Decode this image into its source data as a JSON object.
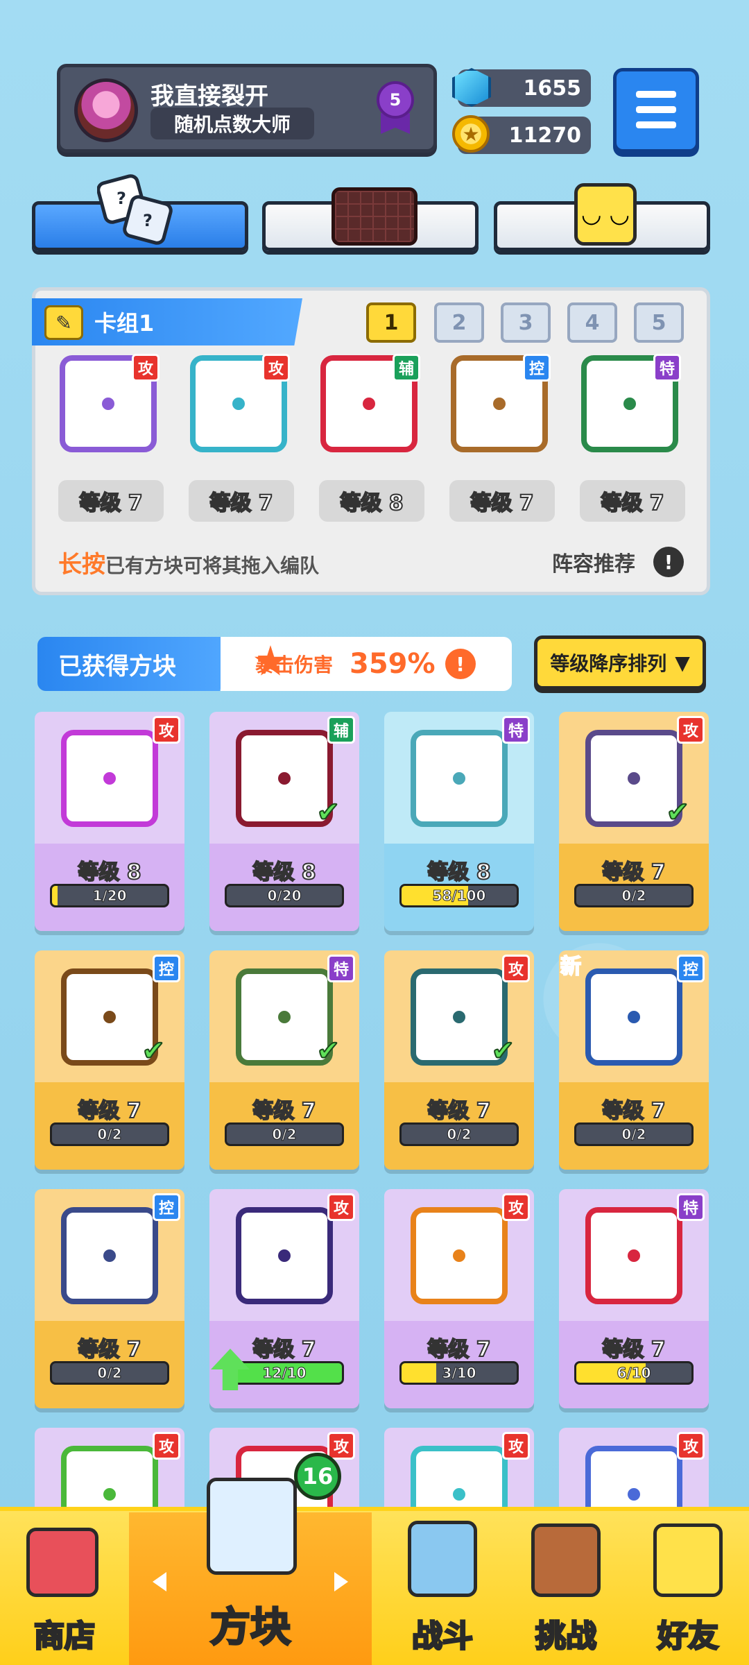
{
  "profile": {
    "name": "我直接裂开",
    "title": "随机点数大师",
    "rank_level": "5"
  },
  "currency": {
    "gems": "1655",
    "coins": "11270"
  },
  "deck": {
    "title": "卡组1",
    "numbers": [
      "1",
      "2",
      "3",
      "4",
      "5"
    ],
    "active_number": "1",
    "slots": [
      {
        "role": "攻",
        "level": "等级 7",
        "color": "#8a5bd6"
      },
      {
        "role": "攻",
        "level": "等级 7",
        "color": "#36b3c9"
      },
      {
        "role": "辅",
        "level": "等级 8",
        "color": "#d8263f"
      },
      {
        "role": "控",
        "level": "等级 7",
        "color": "#a86b2a"
      },
      {
        "role": "特",
        "level": "等级 7",
        "color": "#2a8a4a"
      }
    ],
    "hint_accent": "长按",
    "hint_rest": "已有方块可将其拖入编队",
    "lineup_label": "阵容推荐"
  },
  "owned": {
    "title": "已获得方块",
    "crit_label": "暴击伤害",
    "crit_value": "359%",
    "sort_label": "等级降序排列"
  },
  "cards": [
    {
      "role": "攻",
      "level": "等级 8",
      "progress": "1/20",
      "fill": 0.05,
      "theme": "purple",
      "color": "#c23ad8"
    },
    {
      "role": "辅",
      "level": "等级 8",
      "progress": "0/20",
      "fill": 0,
      "theme": "purple",
      "color": "#8a1a30",
      "check": true
    },
    {
      "role": "特",
      "level": "等级 8",
      "progress": "58/100",
      "fill": 0.58,
      "theme": "blue",
      "color": "#4aa8b8"
    },
    {
      "role": "攻",
      "level": "等级 7",
      "progress": "0/2",
      "fill": 0,
      "theme": "gold",
      "color": "#5a4a8a",
      "check": true
    },
    {
      "role": "控",
      "level": "等级 7",
      "progress": "0/2",
      "fill": 0,
      "theme": "gold",
      "color": "#7a4a1a",
      "check": true
    },
    {
      "role": "特",
      "level": "等级 7",
      "progress": "0/2",
      "fill": 0,
      "theme": "gold",
      "color": "#4a7a3a",
      "check": true
    },
    {
      "role": "攻",
      "level": "等级 7",
      "progress": "0/2",
      "fill": 0,
      "theme": "gold",
      "color": "#2a6a70",
      "check": true
    },
    {
      "role": "控",
      "level": "等级 7",
      "progress": "0/2",
      "fill": 0,
      "theme": "gold",
      "color": "#2a5ab0",
      "new": "新"
    },
    {
      "role": "控",
      "level": "等级 7",
      "progress": "0/2",
      "fill": 0,
      "theme": "gold",
      "color": "#3a4a8a"
    },
    {
      "role": "攻",
      "level": "等级 7",
      "progress": "12/10",
      "fill": 1,
      "theme": "purple",
      "color": "#3a2a7a",
      "upgrade": true
    },
    {
      "role": "攻",
      "level": "等级 7",
      "progress": "3/10",
      "fill": 0.3,
      "theme": "purple",
      "color": "#e8821a"
    },
    {
      "role": "特",
      "level": "等级 7",
      "progress": "6/10",
      "fill": 0.6,
      "theme": "purple",
      "color": "#d8263f"
    },
    {
      "role": "攻",
      "theme": "purple",
      "color": "#4ab83a"
    },
    {
      "role": "攻",
      "theme": "purple",
      "color": "#d8263f"
    },
    {
      "role": "攻",
      "theme": "purple",
      "color": "#3ac0c8"
    },
    {
      "role": "攻",
      "theme": "purple",
      "color": "#4a6ad8"
    }
  ],
  "nav": {
    "shop": "商店",
    "dice": "方块",
    "battle": "战斗",
    "challenge": "挑战",
    "friends": "好友",
    "dice_badge": "16"
  }
}
